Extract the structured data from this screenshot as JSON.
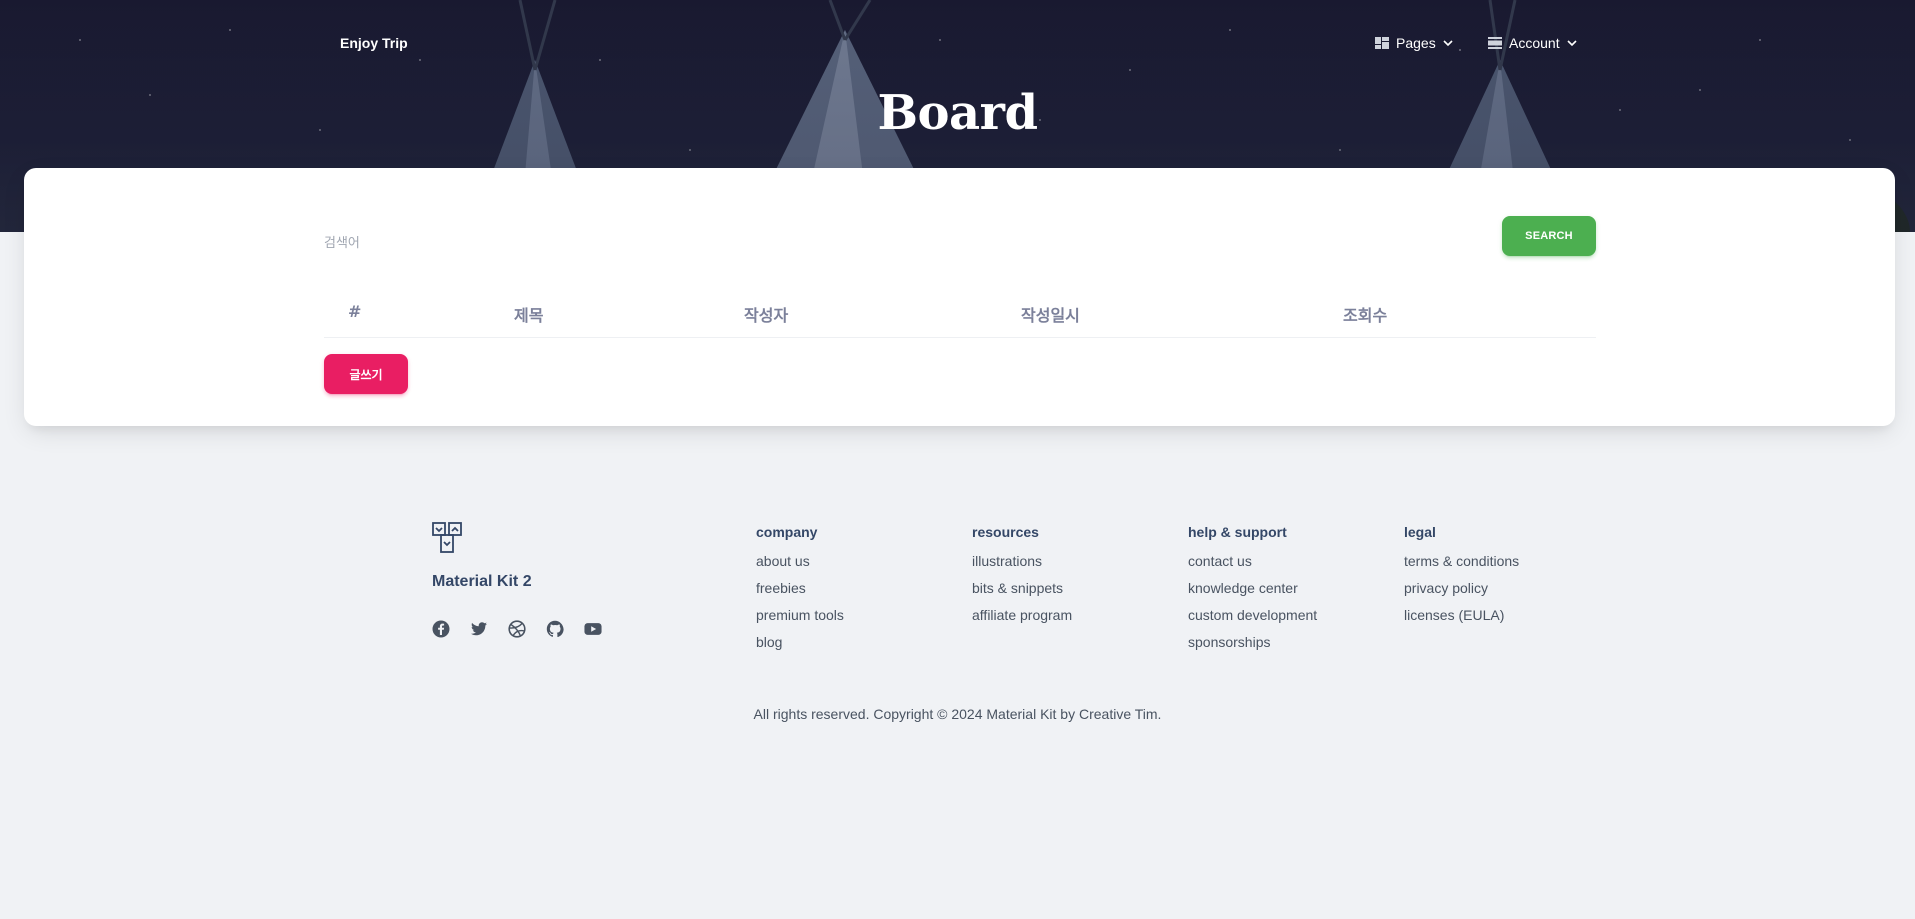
{
  "navbar": {
    "brand": "Enjoy Trip",
    "items": [
      {
        "label": "Pages",
        "icon": "dashboard-icon"
      },
      {
        "label": "Account",
        "icon": "view-day-icon"
      }
    ]
  },
  "hero": {
    "title": "Board"
  },
  "search": {
    "placeholder": "검색어",
    "button_label": "SEARCH"
  },
  "table": {
    "columns": [
      "#",
      "제목",
      "작성자",
      "작성일시",
      "조회수"
    ],
    "rows": []
  },
  "write_button": "글쓰기",
  "footer": {
    "brand": "Material Kit 2",
    "socials": [
      "facebook-icon",
      "twitter-icon",
      "dribbble-icon",
      "github-icon",
      "youtube-icon"
    ],
    "columns": [
      {
        "heading": "company",
        "links": [
          "about us",
          "freebies",
          "premium tools",
          "blog"
        ]
      },
      {
        "heading": "resources",
        "links": [
          "illustrations",
          "bits & snippets",
          "affiliate program"
        ]
      },
      {
        "heading": "help & support",
        "links": [
          "contact us",
          "knowledge center",
          "custom development",
          "sponsorships"
        ]
      },
      {
        "heading": "legal",
        "links": [
          "terms & conditions",
          "privacy policy",
          "licenses (EULA)"
        ]
      }
    ],
    "copyright": "All rights reserved. Copyright © 2024 Material Kit by Creative Tim."
  },
  "colors": {
    "search_button": "#4caf50",
    "write_button": "#e91e63",
    "page_background": "#f0f2f5",
    "text_dark": "#344767"
  }
}
